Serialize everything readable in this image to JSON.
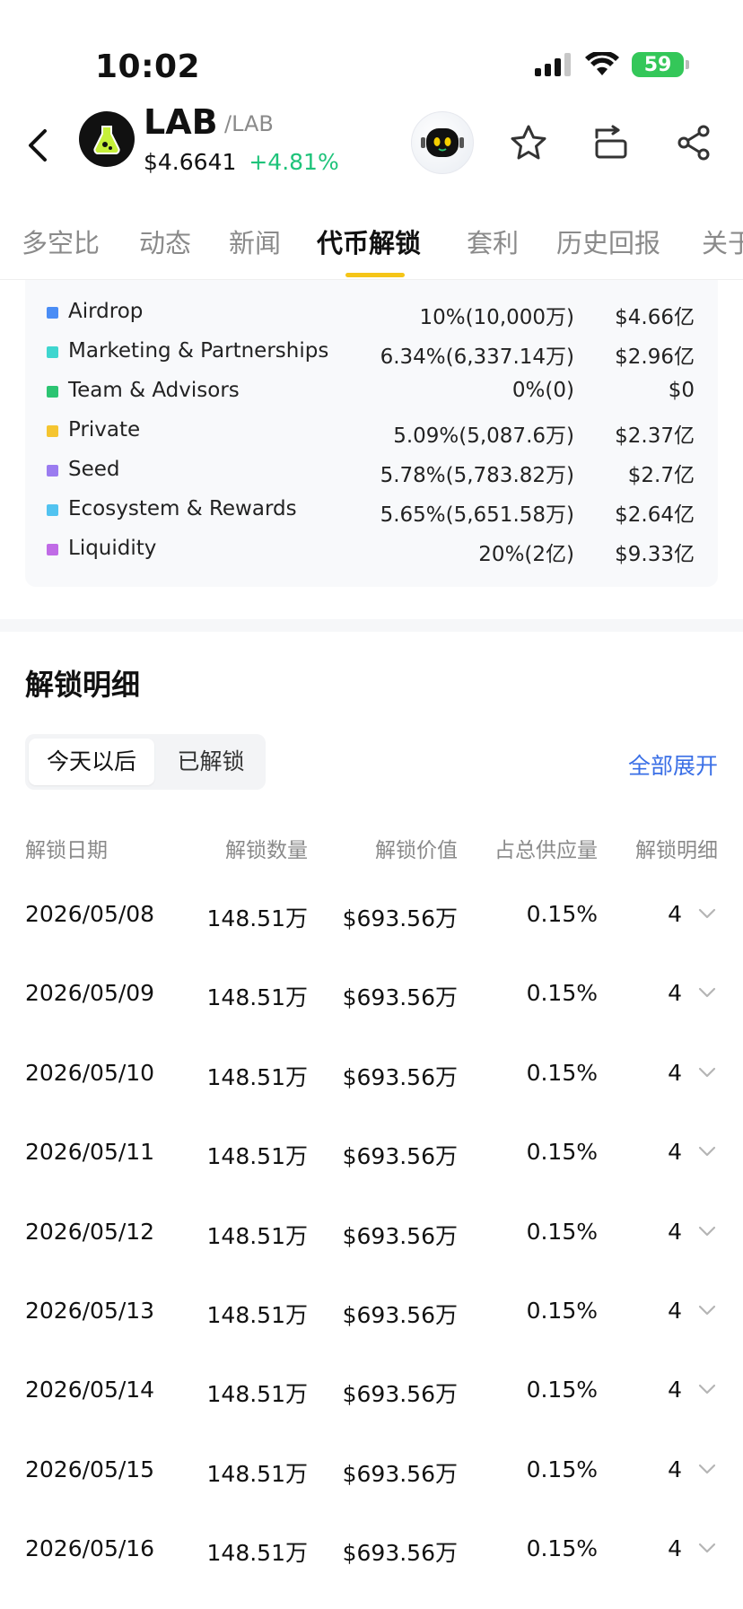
{
  "status_bar": {
    "time": "10:02",
    "battery": "59"
  },
  "header": {
    "coin_name": "LAB",
    "coin_pair": "/LAB",
    "price": "$4.6641",
    "change": "+4.81%"
  },
  "tabs": [
    {
      "label": "多空比"
    },
    {
      "label": "动态"
    },
    {
      "label": "新闻"
    },
    {
      "label": "代币解锁"
    },
    {
      "label": "套利"
    },
    {
      "label": "历史回报"
    },
    {
      "label": "关于"
    }
  ],
  "allocation": [
    {
      "name": "Airdrop",
      "pct": "10%(10,000万)",
      "value": "$4.66亿",
      "color": "#4a8df5"
    },
    {
      "name": "Marketing & Partnerships",
      "pct": "6.34%(6,337.14万)",
      "value": "$2.96亿",
      "color": "#3fd6cf"
    },
    {
      "name": "Team & Advisors",
      "pct": "0%(0)",
      "value": "$0",
      "color": "#2cc472"
    },
    {
      "name": "Private",
      "pct": "5.09%(5,087.6万)",
      "value": "$2.37亿",
      "color": "#f5c530"
    },
    {
      "name": "Seed",
      "pct": "5.78%(5,783.82万)",
      "value": "$2.7亿",
      "color": "#9b7cf0"
    },
    {
      "name": "Ecosystem & Rewards",
      "pct": "5.65%(5,651.58万)",
      "value": "$2.64亿",
      "color": "#52c3f0"
    },
    {
      "name": "Liquidity",
      "pct": "20%(2亿)",
      "value": "$9.33亿",
      "color": "#c06be6"
    }
  ],
  "unlock_section": {
    "title": "解锁明细",
    "segments": [
      "今天以后",
      "已解锁"
    ],
    "expand_all": "全部展开",
    "columns": [
      "解锁日期",
      "解锁数量",
      "解锁价值",
      "占总供应量",
      "解锁明细"
    ],
    "rows": [
      {
        "date": "2026/05/08",
        "amount": "148.51万",
        "value": "$693.56万",
        "pct": "0.15%",
        "count": "4"
      },
      {
        "date": "2026/05/09",
        "amount": "148.51万",
        "value": "$693.56万",
        "pct": "0.15%",
        "count": "4"
      },
      {
        "date": "2026/05/10",
        "amount": "148.51万",
        "value": "$693.56万",
        "pct": "0.15%",
        "count": "4"
      },
      {
        "date": "2026/05/11",
        "amount": "148.51万",
        "value": "$693.56万",
        "pct": "0.15%",
        "count": "4"
      },
      {
        "date": "2026/05/12",
        "amount": "148.51万",
        "value": "$693.56万",
        "pct": "0.15%",
        "count": "4"
      },
      {
        "date": "2026/05/13",
        "amount": "148.51万",
        "value": "$693.56万",
        "pct": "0.15%",
        "count": "4"
      },
      {
        "date": "2026/05/14",
        "amount": "148.51万",
        "value": "$693.56万",
        "pct": "0.15%",
        "count": "4"
      },
      {
        "date": "2026/05/15",
        "amount": "148.51万",
        "value": "$693.56万",
        "pct": "0.15%",
        "count": "4"
      },
      {
        "date": "2026/05/16",
        "amount": "148.51万",
        "value": "$693.56万",
        "pct": "0.15%",
        "count": "4"
      }
    ]
  },
  "colors": {
    "accent_yellow": "#f5c518",
    "positive_green": "#1ec37a",
    "link_blue": "#3a6fe6"
  },
  "icons": [
    "back-arrow-icon",
    "coin-logo-icon",
    "ai-bot-icon",
    "star-icon",
    "swap-icon",
    "share-icon",
    "chevron-down-icon"
  ]
}
